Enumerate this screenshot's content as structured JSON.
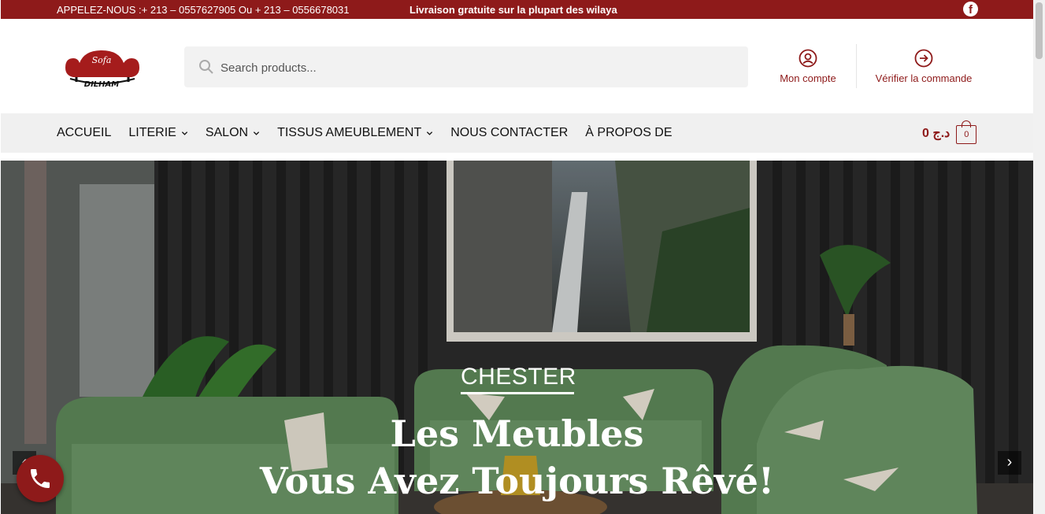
{
  "topbar": {
    "phone_text": "APPELEZ-NOUS :+ 213 – 0557627905 Ou + 213 – 0556678031",
    "promo_text": "Livraison gratuite sur la plupart des wilaya",
    "social_icon": "facebook-icon",
    "background": "#8e1a1a"
  },
  "header": {
    "logo": {
      "script": "Sofa",
      "name": "DILHAM"
    },
    "search": {
      "placeholder": "Search products...",
      "value": "",
      "icon": "search-icon"
    },
    "account": {
      "label": "Mon compte",
      "icon": "user-circle-icon"
    },
    "checkout": {
      "label": "Vérifier la commande",
      "icon": "arrow-circle-icon"
    }
  },
  "nav": {
    "items": [
      {
        "label": "ACCUEIL",
        "dropdown": false
      },
      {
        "label": "LITERIE",
        "dropdown": true
      },
      {
        "label": "SALON",
        "dropdown": true
      },
      {
        "label": "TISSUS AMEUBLEMENT",
        "dropdown": true
      },
      {
        "label": "NOUS CONTACTER",
        "dropdown": false
      },
      {
        "label": "À PROPOS DE",
        "dropdown": false
      }
    ],
    "cart": {
      "price": "0",
      "currency": "د.ج",
      "count": "0",
      "icon": "shopping-bag-icon"
    }
  },
  "hero": {
    "kicker": "CHESTER",
    "line1": "Les Meubles",
    "line2": "Vous Avez Toujours Rêvé!",
    "prev_icon": "chevron-left-icon",
    "next_icon": "chevron-right-icon"
  },
  "call_button": {
    "icon": "phone-icon"
  },
  "colors": {
    "brand": "#8e1a1a",
    "nav_bg": "#f0f0f0",
    "text": "#111111"
  }
}
